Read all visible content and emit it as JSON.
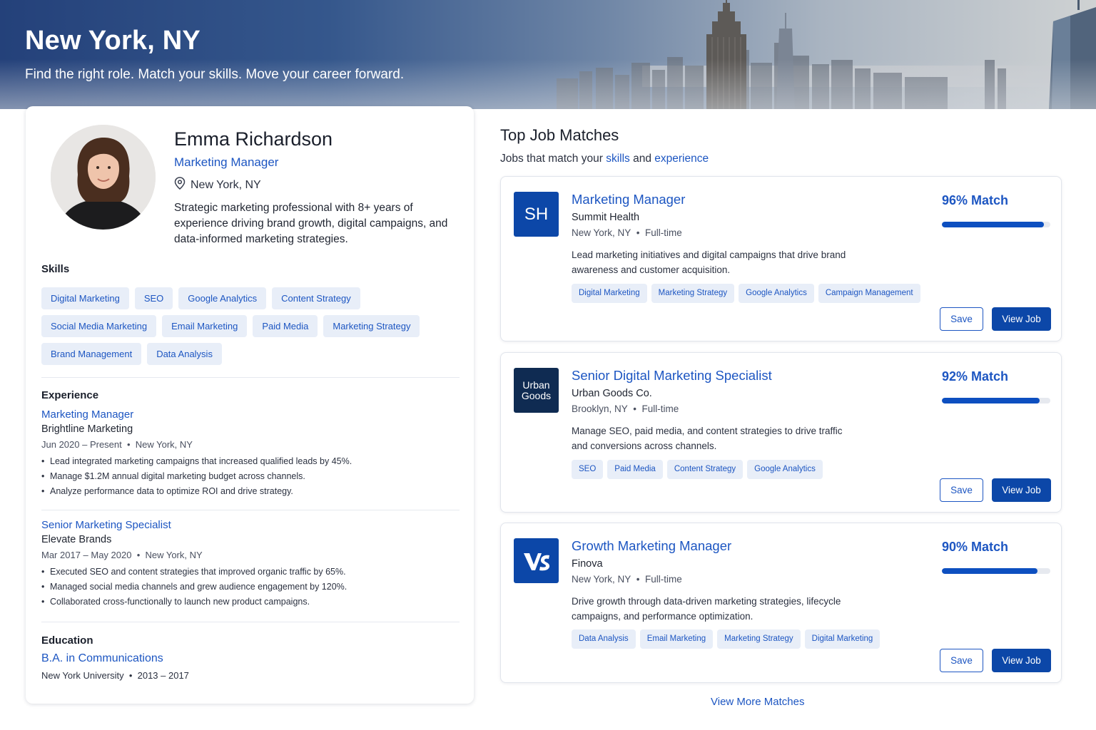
{
  "hero": {
    "title": "New York, NY",
    "subtitle": "Find the right role. Match your skills. Move your career forward."
  },
  "profile": {
    "name": "Emma Richardson",
    "title": "Marketing Manager",
    "location": "New York, NY",
    "location_icon": "map-pin-icon",
    "bio": "Strategic marketing professional with 8+ years of experience driving brand growth, digital campaigns, and data-informed marketing strategies.",
    "skills_heading": "Skills",
    "skills": [
      "Digital Marketing",
      "SEO",
      "Google Analytics",
      "Content Strategy",
      "Social Media Marketing",
      "Email Marketing",
      "Paid Media",
      "Marketing Strategy",
      "Brand Management",
      "Data Analysis"
    ],
    "experience_heading": "Experience",
    "experience": [
      {
        "role": "Marketing Manager",
        "company": "Brightline Marketing",
        "dates": "Jun 2020 – Present",
        "location": "New York, NY",
        "bullets": [
          "Lead integrated marketing campaigns that increased qualified leads by 45%.",
          "Manage $1.2M annual digital marketing budget across channels.",
          "Analyze performance data to optimize ROI and drive strategy."
        ]
      },
      {
        "role": "Senior Marketing Specialist",
        "company": "Elevate Brands",
        "dates": "Mar 2017 – May 2020",
        "location": "New York, NY",
        "bullets": [
          "Executed SEO and content strategies that improved organic traffic by 65%.",
          "Managed social media channels and grew audience engagement by 120%.",
          "Collaborated cross-functionally to launch new product campaigns."
        ]
      }
    ],
    "education_heading": "Education",
    "education": {
      "degree": "B.A. in Communications",
      "school": "New York University",
      "years": "2013 – 2017"
    }
  },
  "matches": {
    "title": "Top Job Matches",
    "subtitle_prefix": "Jobs that match your ",
    "subtitle_skills": "skills",
    "subtitle_and": " and ",
    "subtitle_experience": "experience",
    "jobs": [
      {
        "title": "Marketing Manager",
        "company": "Summit Health",
        "logo_text": "SH",
        "logo_color": "#0c47a8",
        "location": "New York, NY",
        "type": "Full-time",
        "description": "Lead marketing initiatives and digital campaigns that drive brand awareness and customer acquisition.",
        "tags": [
          "Digital Marketing",
          "Marketing Strategy",
          "Google Analytics",
          "Campaign Management"
        ],
        "match_label": "96% Match",
        "match_fraction": 0.94,
        "save_label": "Save",
        "view_label": "View Job"
      },
      {
        "title": "Senior Digital Marketing Specialist",
        "company": "Urban Goods Co.",
        "logo_text_line1": "Urban",
        "logo_text_line2": "Goods",
        "logo_color": "#0f2b52",
        "location": "Brooklyn, NY",
        "type": "Full-time",
        "description": "Manage SEO, paid media, and content strategies to drive traffic and conversions across channels.",
        "tags": [
          "SEO",
          "Paid Media",
          "Content Strategy",
          "Google Analytics"
        ],
        "match_label": "92% Match",
        "match_fraction": 0.9,
        "save_label": "Save",
        "view_label": "View Job"
      },
      {
        "title": "Growth Marketing Manager",
        "company": "Finova",
        "logo_icon": "finova-logo-icon",
        "logo_color": "#0c47a8",
        "location": "New York, NY",
        "type": "Full-time",
        "description": "Drive growth through data-driven marketing strategies, lifecycle campaigns, and performance optimization.",
        "tags": [
          "Data Analysis",
          "Email Marketing",
          "Marketing Strategy",
          "Digital Marketing"
        ],
        "match_label": "90% Match",
        "match_fraction": 0.88,
        "save_label": "Save",
        "view_label": "View Job"
      }
    ],
    "view_more": "View More Matches"
  }
}
